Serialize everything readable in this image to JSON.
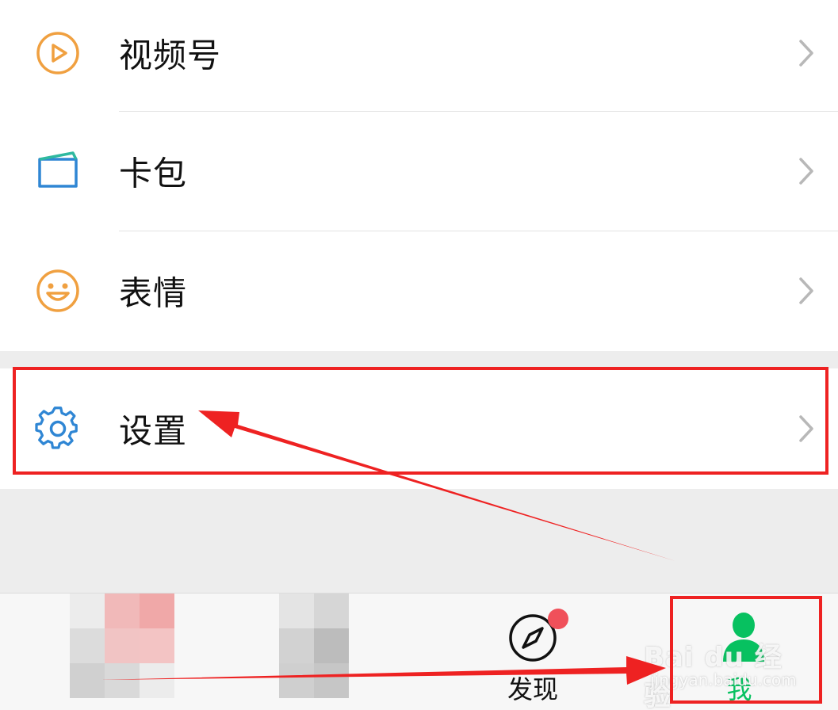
{
  "menu": {
    "items": [
      {
        "label": "视频号",
        "icon": "channels-play-icon"
      },
      {
        "label": "卡包",
        "icon": "card-wallet-icon"
      },
      {
        "label": "表情",
        "icon": "smiley-face-icon"
      }
    ],
    "settings": {
      "label": "设置",
      "icon": "gear-icon"
    }
  },
  "tabbar": {
    "tabs": [
      {
        "label": "",
        "state": "blurred"
      },
      {
        "label": "",
        "state": "blurred"
      },
      {
        "label": "发现",
        "icon": "compass-icon",
        "badge": true
      },
      {
        "label": "我",
        "icon": "person-icon",
        "selected": true
      }
    ]
  },
  "watermark": {
    "text": "Bai du 经验",
    "sub": "jingyan.baidu.com"
  },
  "colors": {
    "accent_green": "#07c160",
    "orange": "#f0a040",
    "blue": "#2f86d4",
    "annotation_red": "#ee2222",
    "badge_red": "#f0505a"
  }
}
